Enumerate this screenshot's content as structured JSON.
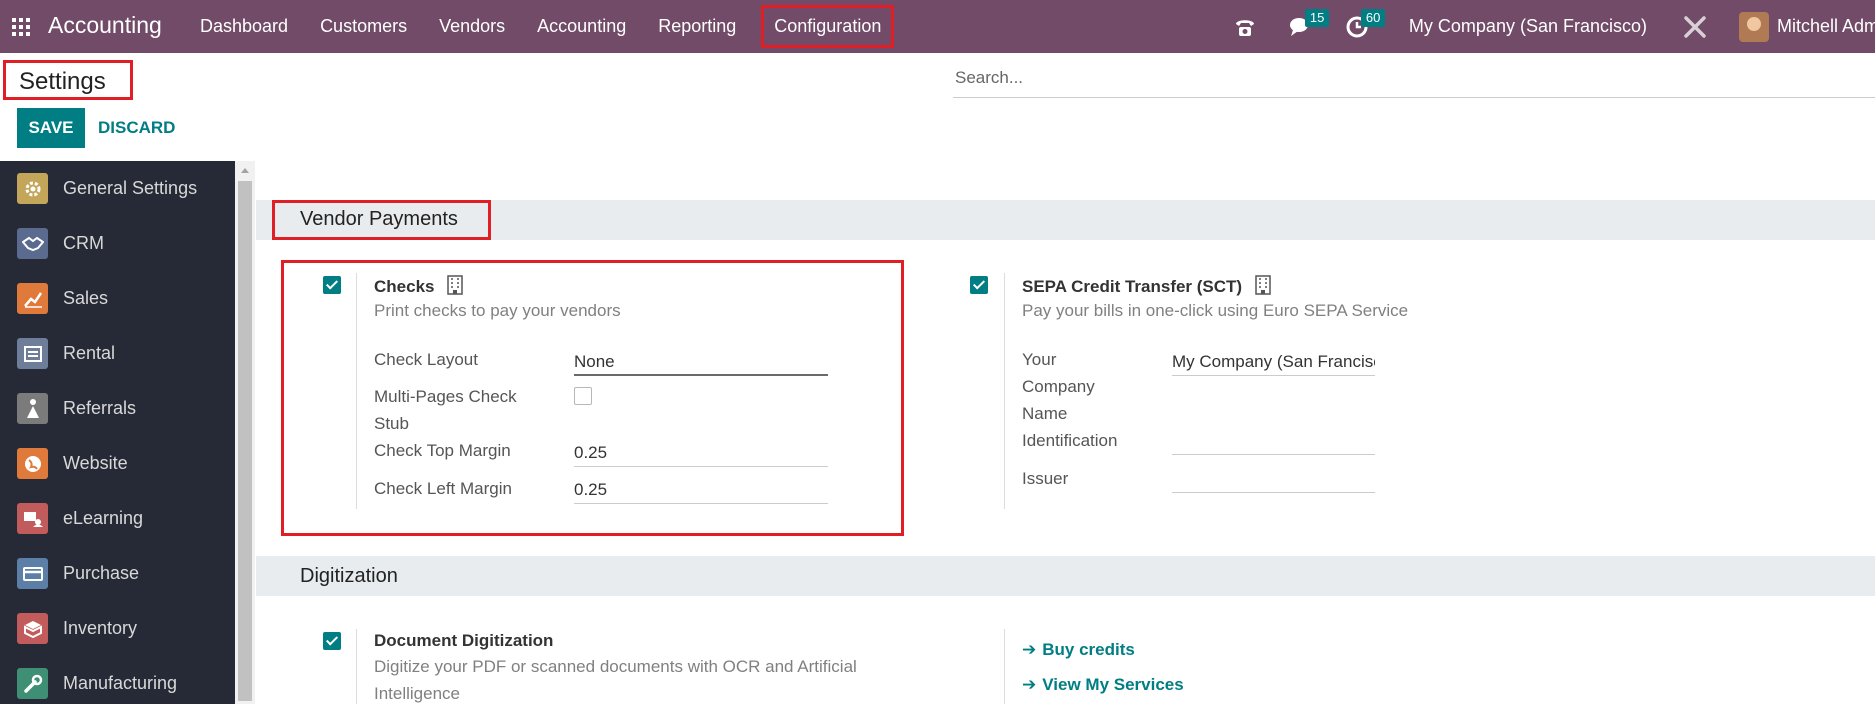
{
  "navbar": {
    "app_name": "Accounting",
    "menu": [
      "Dashboard",
      "Customers",
      "Vendors",
      "Accounting",
      "Reporting",
      "Configuration"
    ],
    "messages_count": "15",
    "activities_count": "60",
    "company": "My Company (San Francisco)",
    "user": "Mitchell Admin"
  },
  "control_panel": {
    "title": "Settings",
    "search_placeholder": "Search...",
    "save_label": "SAVE",
    "discard_label": "DISCARD"
  },
  "sidebar": {
    "items": [
      {
        "label": "General Settings",
        "icon": "gear-icon",
        "color": "#c4a65a"
      },
      {
        "label": "CRM",
        "icon": "handshake-icon",
        "color": "#5b6a8f"
      },
      {
        "label": "Sales",
        "icon": "chart-icon",
        "color": "#e07a3a"
      },
      {
        "label": "Rental",
        "icon": "rental-icon",
        "color": "#6e7e9a"
      },
      {
        "label": "Referrals",
        "icon": "referrals-icon",
        "color": "#7b7b7b"
      },
      {
        "label": "Website",
        "icon": "globe-icon",
        "color": "#e07a3a"
      },
      {
        "label": "eLearning",
        "icon": "elearning-icon",
        "color": "#c25c5c"
      },
      {
        "label": "Purchase",
        "icon": "purchase-icon",
        "color": "#5b7fa6"
      },
      {
        "label": "Inventory",
        "icon": "inventory-icon",
        "color": "#c25c5c"
      },
      {
        "label": "Manufacturing",
        "icon": "wrench-icon",
        "color": "#3f8f75"
      }
    ]
  },
  "vendor_payments": {
    "title": "Vendor Payments",
    "checks": {
      "title": "Checks",
      "description": "Print checks to pay your vendors",
      "check_layout_label": "Check Layout",
      "check_layout_value": "None",
      "multi_pages_label_1": "Multi-Pages Check",
      "multi_pages_label_2": "Stub",
      "top_margin_label": "Check Top Margin",
      "top_margin_value": "0.25",
      "left_margin_label": "Check Left Margin",
      "left_margin_value": "0.25"
    },
    "sepa": {
      "title": "SEPA Credit Transfer (SCT)",
      "description": "Pay your bills in one-click using Euro SEPA Service",
      "company_name_label": [
        "Your",
        "Company",
        "Name"
      ],
      "company_name_value": "My Company (San Francisco)",
      "identification_label": "Identification",
      "issuer_label": "Issuer"
    }
  },
  "digitization": {
    "title": "Digitization",
    "document": {
      "title": "Document Digitization",
      "description_1": "Digitize your PDF or scanned documents with OCR and Artificial",
      "description_2": "Intelligence"
    },
    "buy_credits": "Buy credits",
    "view_services": "View My Services"
  },
  "colors": {
    "navbar": "#714b67",
    "accent": "#017e84",
    "highlight": "#e01e26",
    "sidebar": "#262a36"
  }
}
